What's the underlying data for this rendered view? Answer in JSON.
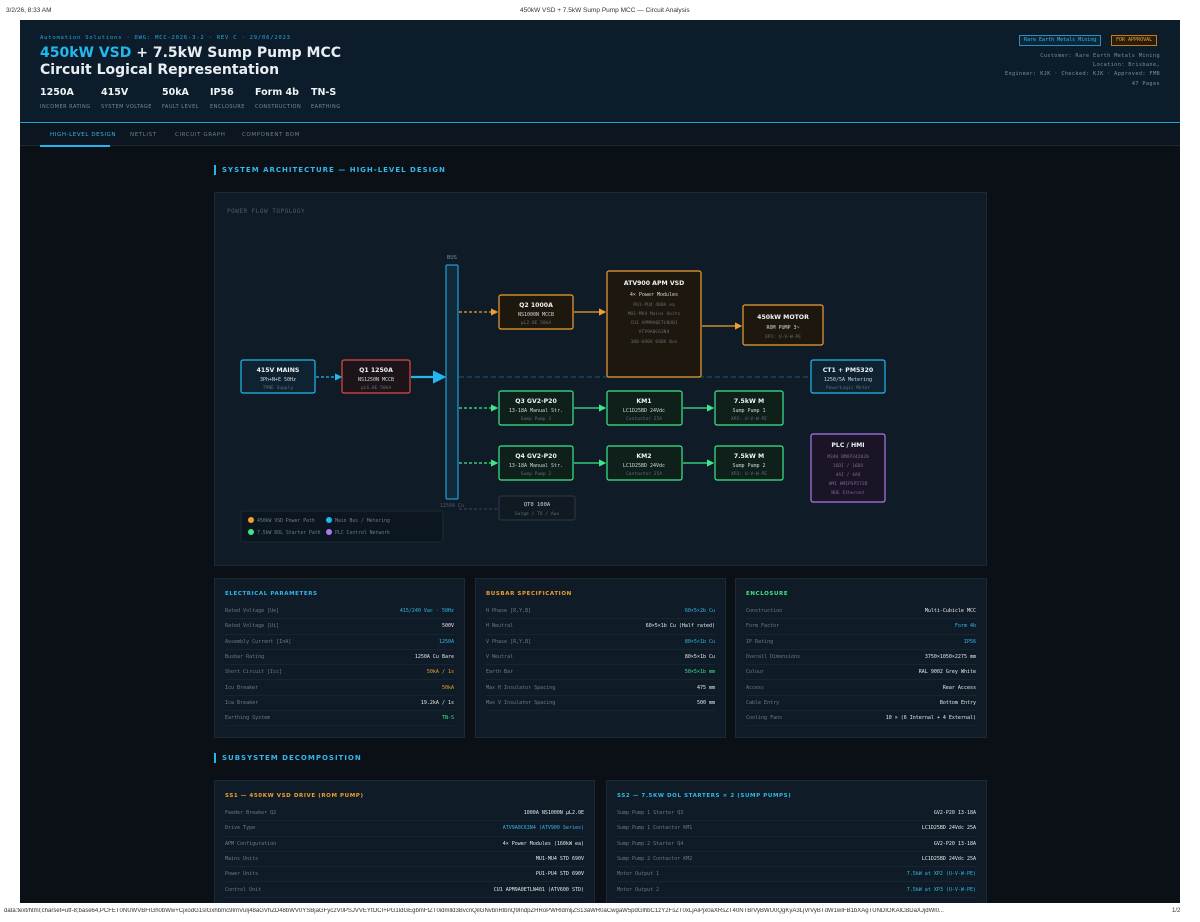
{
  "print_header": {
    "datetime": "3/2/26, 8:33 AM",
    "page_title": "450kW VSD + 7.5kW Sump Pump MCC — Circuit Analysis"
  },
  "print_footer": {
    "url": "data:text/html;charset=utf-8;base64,PCFET0NUWVBFIGh0bWw+CjxodG1sIGxhbmc9ImVuIj48aGVhZD48bWV0YSBjaGFyc2V0PSJVVEYtOCI+PG1ldGEgbmFtZT0idmlld3BvcnQiIGNvbnRlbnQ9IndpZHRoPWRldmljZS13aWR0aCwgaW5pdGlhbC1zY2FsZT0xLjAiPjx0aXRsZT40NTBrVyBWU0QgKyA3LjVrVyBTdW1wIFB1bXAgTUNDIOKAlCBDaXJjdWl0...",
    "page_num": "1/2"
  },
  "header": {
    "subtitle": "Automation Solutions · DWG: MCC-2026-3-2 · REV C · 29/06/2023",
    "title_accent": "450kW VSD",
    "title_rest": " + 7.5kW Sump Pump MCC",
    "title_line2": "Circuit Logical Representation",
    "kpis": [
      {
        "value": "1250A",
        "label": "INCOMER RATING"
      },
      {
        "value": "415V",
        "label": "SYSTEM VOLTAGE"
      },
      {
        "value": "50kA",
        "label": "FAULT LEVEL"
      },
      {
        "value": "IP56",
        "label": "ENCLOSURE"
      },
      {
        "value": "Form 4b",
        "label": "CONSTRUCTION"
      },
      {
        "value": "TN-S",
        "label": "EARTHING"
      }
    ],
    "badge_client": "Rare Earth Metals Mining",
    "badge_status": "FOR APPROVAL",
    "meta": [
      "Customer: Rare Earth Metals Mining",
      "Location: Brisbane,",
      "Engineer: KJK · Checked: KJK · Approved: FMB",
      "47 Pages"
    ]
  },
  "tabs": [
    "HIGH-LEVEL DESIGN",
    "NETLIST",
    "CIRCUIT GRAPH",
    "COMPONENT BOM"
  ],
  "section1_title": "SYSTEM ARCHITECTURE — HIGH-LEVEL DESIGN",
  "section2_title": "SUBSYSTEM DECOMPOSITION",
  "diagram": {
    "topology_label": "POWER FLOW TOPOLOGY",
    "bus_label": "BUS",
    "bus_rating": "1250A Cu",
    "mains": {
      "t": "415V MAINS",
      "s1": "3Ph+N+E 50Hz",
      "s2": "TPNE Supply"
    },
    "q1": {
      "t": "Q1 1250A",
      "s1": "NS1250N MCCB",
      "s2": "μL6.0E 50kA"
    },
    "q2": {
      "t": "Q2 1000A",
      "s1": "NS1000N MCCB",
      "s2": "μL2.0E 50kA"
    },
    "vsd": {
      "t": "ATV900 APM VSD",
      "s1": "4× Power Modules",
      "s2": "PU1-PU4 400A ea",
      "s3": "MU1-MU4 Mains Units",
      "s4": "CU1 APM9A0ETLN401",
      "s5": "ATV9A0C63N4",
      "s6": "380-690V 690V Bus"
    },
    "motor450": {
      "t": "450kW MOTOR",
      "s1": "ROM PUMP 3~",
      "s2": "XP1: U-V-W-PE"
    },
    "ct1": {
      "t": "CT1 + PM5320",
      "s1": "1250/5A Metering",
      "s2": "PowerLogic Meter"
    },
    "q3": {
      "t": "Q3 GV2-P20",
      "s1": "13-18A Manual Str.",
      "s2": "Sump Pump 1"
    },
    "km1": {
      "t": "KM1",
      "s1": "LC1D25BD 24Vdc",
      "s2": "Contactor 25A"
    },
    "m1": {
      "t": "7.5kW M",
      "s1": "Sump Pump 1",
      "s2": "XP2: U-V-W-PE"
    },
    "q4": {
      "t": "Q4 GV2-P20",
      "s1": "13-18A Manual Str.",
      "s2": "Sump Pump 2"
    },
    "km2": {
      "t": "KM2",
      "s1": "LC1D25BD 24Vdc",
      "s2": "Contactor 25A"
    },
    "m2": {
      "t": "7.5kW M",
      "s1": "Sump Pump 2",
      "s2": "XP3: U-V-W-PE"
    },
    "plc": {
      "t": "PLC / HMI",
      "s1": "M340 BMXP342020",
      "s2": "16DI / 16DO",
      "s3": "4AI / 4AO",
      "s4": "HMI HMIPSP572D",
      "s5": "NOE Ethernet"
    },
    "qt0": {
      "t": "QT0 100A",
      "s1": "Surge / TX / Aux"
    },
    "legend": [
      {
        "label": "450kW VSD Power Path",
        "color": "#f0a030"
      },
      {
        "label": "Main Bus / Metering",
        "color": "#22b8ef"
      },
      {
        "label": "7.5kW DOL Starter Path",
        "color": "#3ee88a"
      },
      {
        "label": "PLC Control Network",
        "color": "#b078f0"
      }
    ]
  },
  "cards": {
    "electrical": {
      "title": "ELECTRICAL PARAMETERS",
      "rows": [
        {
          "k": "Rated Voltage [Ue]",
          "v": "415/240 Vac · 50Hz",
          "c": "blue"
        },
        {
          "k": "Rated Voltage [Ui]",
          "v": "500V",
          "c": ""
        },
        {
          "k": "Assembly Current [InA]",
          "v": "1250A",
          "c": "blue"
        },
        {
          "k": "Busbar Rating",
          "v": "1250A Cu Bare",
          "c": ""
        },
        {
          "k": "Short Circuit [Icc]",
          "v": "50kA / 1s",
          "c": "org"
        },
        {
          "k": "Icu Breaker",
          "v": "50kA",
          "c": "org"
        },
        {
          "k": "Icw Breaker",
          "v": "19.2kA / 1s",
          "c": ""
        },
        {
          "k": "Earthing System",
          "v": "TN-S",
          "c": "grn"
        }
      ]
    },
    "busbar": {
      "title": "BUSBAR SPECIFICATION",
      "rows": [
        {
          "k": "H Phase [R,Y,B]",
          "v": "60×5×2b Cu",
          "c": "blue"
        },
        {
          "k": "H Neutral",
          "v": "60×5×1b Cu (Half rated)",
          "c": ""
        },
        {
          "k": "V Phase [R,Y,B]",
          "v": "80×5×1b Cu",
          "c": "blue"
        },
        {
          "k": "V Neutral",
          "v": "80×5×1b Cu",
          "c": ""
        },
        {
          "k": "Earth Bar",
          "v": "50×5×1b mm",
          "c": "grn"
        },
        {
          "k": "Max H Insulator Spacing",
          "v": "475 mm",
          "c": ""
        },
        {
          "k": "Max V Insulator Spacing",
          "v": "500 mm",
          "c": ""
        }
      ]
    },
    "enclosure": {
      "title": "ENCLOSURE",
      "rows": [
        {
          "k": "Construction",
          "v": "Multi-Cubicle MCC",
          "c": ""
        },
        {
          "k": "Form Factor",
          "v": "Form 4b",
          "c": "blue"
        },
        {
          "k": "IP Rating",
          "v": "IP56",
          "c": "blue"
        },
        {
          "k": "Overall Dimensions",
          "v": "3750×1050×2275 mm",
          "c": ""
        },
        {
          "k": "Colour",
          "v": "RAL 9002 Grey White",
          "c": ""
        },
        {
          "k": "Access",
          "v": "Rear Access",
          "c": ""
        },
        {
          "k": "Cable Entry",
          "v": "Bottom Entry",
          "c": ""
        },
        {
          "k": "Cooling Fans",
          "v": "10 × (6 Internal + 4 External)",
          "c": ""
        }
      ]
    },
    "ss1": {
      "title": "SS1 — 450KW VSD DRIVE (ROM PUMP)",
      "rows": [
        {
          "k": "Feeder Breaker Q2",
          "v": "1000A NS1000N μL2.0E",
          "c": ""
        },
        {
          "k": "Drive Type",
          "v": "ATV9A0C63N4 (ATV900 Series)",
          "c": "blue"
        },
        {
          "k": "APM Configuration",
          "v": "4× Power Modules (160kW ea)",
          "c": ""
        },
        {
          "k": "Mains Units",
          "v": "MU1-MU4 STD 690V",
          "c": ""
        },
        {
          "k": "Power Units",
          "v": "PU1-PU4 STD 690V",
          "c": ""
        },
        {
          "k": "Control Unit",
          "v": "CU1 APM9A0ETLN401 (ATV600 STD)",
          "c": ""
        }
      ]
    },
    "ss2": {
      "title": "SS2 — 7.5KW DOL STARTERS × 2 (SUMP PUMPS)",
      "rows": [
        {
          "k": "Sump Pump 1 Starter Q3",
          "v": "GV2-P20 13-18A",
          "c": ""
        },
        {
          "k": "Sump Pump 1 Contactor KM1",
          "v": "LC1D25BD 24Vdc 25A",
          "c": ""
        },
        {
          "k": "Sump Pump 2 Starter Q4",
          "v": "GV2-P20 13-18A",
          "c": ""
        },
        {
          "k": "Sump Pump 2 Contactor KM2",
          "v": "LC1D25BD 24Vdc 25A",
          "c": ""
        },
        {
          "k": "Motor Output 1",
          "v": "7.5kW at XP2 (U-V-W-PE)",
          "c": "blue"
        },
        {
          "k": "Motor Output 2",
          "v": "7.5kW at XP3 (U-V-W-PE)",
          "c": "blue"
        }
      ]
    }
  }
}
